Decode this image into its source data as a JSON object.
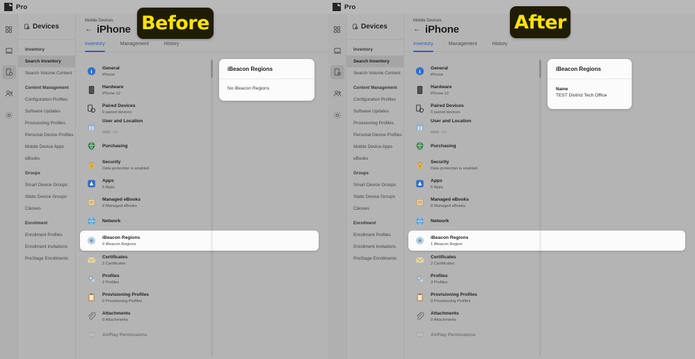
{
  "app": {
    "logo_text": "Pro",
    "logo_icon": "jamf-pro-logo-icon"
  },
  "rail": {
    "items": [
      {
        "name": "dashboard-icon",
        "label": "Dashboard",
        "active": false
      },
      {
        "name": "computers-icon",
        "label": "Computers",
        "active": false
      },
      {
        "name": "devices-icon",
        "label": "Devices",
        "active": true
      },
      {
        "name": "users-icon",
        "label": "Users",
        "active": false
      },
      {
        "name": "settings-gear-icon",
        "label": "Settings",
        "active": false
      }
    ]
  },
  "nav": {
    "header": "Devices",
    "header_icon": "device-icon",
    "groups": [
      {
        "title": "Inventory",
        "items": [
          {
            "label": "Search Inventory",
            "active": true
          },
          {
            "label": "Search Volume Content",
            "active": false
          }
        ]
      },
      {
        "title": "Content Management",
        "items": [
          {
            "label": "Configuration Profiles",
            "active": false
          },
          {
            "label": "Software Updates",
            "active": false
          },
          {
            "label": "Provisioning Profiles",
            "active": false
          },
          {
            "label": "Personal Device Profiles",
            "active": false
          },
          {
            "label": "Mobile Device Apps",
            "active": false
          },
          {
            "label": "eBooks",
            "active": false
          }
        ]
      },
      {
        "title": "Groups",
        "items": [
          {
            "label": "Smart Device Groups",
            "active": false
          },
          {
            "label": "Static Device Groups",
            "active": false
          },
          {
            "label": "Classes",
            "active": false
          }
        ]
      },
      {
        "title": "Enrollment",
        "items": [
          {
            "label": "Enrollment Profiles",
            "active": false
          },
          {
            "label": "Enrollment Invitations",
            "active": false
          },
          {
            "label": "PreStage Enrollments",
            "active": false
          }
        ]
      }
    ]
  },
  "header": {
    "breadcrumb": "Mobile Devices",
    "back_icon": "back-arrow-icon",
    "title": "iPhone"
  },
  "tabs": [
    {
      "label": "Inventory",
      "active": true
    },
    {
      "label": "Management",
      "active": false
    },
    {
      "label": "History",
      "active": false
    }
  ],
  "before": {
    "badge": "Before",
    "inventory": [
      {
        "icon": "general-info-icon",
        "title": "General",
        "sub": "iPhone",
        "selected": false,
        "faded": false
      },
      {
        "icon": "hardware-icon",
        "title": "Hardware",
        "sub": "iPhone 12",
        "selected": false,
        "faded": false
      },
      {
        "icon": "paired-devices-icon",
        "title": "Paired Devices",
        "sub": "0 paired devices",
        "selected": false,
        "faded": false
      },
      {
        "icon": "user-location-icon",
        "title": "User and Location",
        "sub": "",
        "redacted": true,
        "selected": false,
        "faded": false
      },
      {
        "icon": "purchasing-icon",
        "title": "Purchasing",
        "sub": "",
        "selected": false,
        "faded": false
      },
      {
        "icon": "security-lock-icon",
        "title": "Security",
        "sub": "Data protection is enabled",
        "selected": false,
        "faded": false
      },
      {
        "icon": "apps-icon",
        "title": "Apps",
        "sub": "6 Apps",
        "selected": false,
        "faded": false
      },
      {
        "icon": "managed-ebooks-icon",
        "title": "Managed eBooks",
        "sub": "0 Managed eBooks",
        "selected": false,
        "faded": false
      },
      {
        "icon": "network-icon",
        "title": "Network",
        "sub": "",
        "selected": false,
        "faded": false
      },
      {
        "icon": "ibeacon-regions-icon",
        "title": "iBeacon Regions",
        "sub": "0 iBeacon Regions",
        "selected": true,
        "faded": false
      },
      {
        "icon": "certificates-icon",
        "title": "Certificates",
        "sub": "2 Certificates",
        "selected": false,
        "faded": false
      },
      {
        "icon": "profiles-icon",
        "title": "Profiles",
        "sub": "2 Profiles",
        "selected": false,
        "faded": false
      },
      {
        "icon": "provisioning-profiles-icon",
        "title": "Provisioning Profiles",
        "sub": "0 Provisioning Profiles",
        "selected": false,
        "faded": false
      },
      {
        "icon": "attachments-icon",
        "title": "Attachments",
        "sub": "0 Attachments",
        "selected": false,
        "faded": false
      },
      {
        "icon": "airplay-permissions-icon",
        "title": "AirPlay Permissions",
        "sub": "",
        "selected": false,
        "faded": true
      }
    ],
    "card": {
      "title": "iBeacon Regions",
      "empty_text": "No iBeacon Regions"
    }
  },
  "after": {
    "badge": "After",
    "inventory": [
      {
        "icon": "general-info-icon",
        "title": "General",
        "sub": "iPhone",
        "selected": false,
        "faded": false
      },
      {
        "icon": "hardware-icon",
        "title": "Hardware",
        "sub": "iPhone 12",
        "selected": false,
        "faded": false
      },
      {
        "icon": "paired-devices-icon",
        "title": "Paired Devices",
        "sub": "0 paired devices",
        "selected": false,
        "faded": false
      },
      {
        "icon": "user-location-icon",
        "title": "User and Location",
        "sub": "",
        "redacted": true,
        "selected": false,
        "faded": false
      },
      {
        "icon": "purchasing-icon",
        "title": "Purchasing",
        "sub": "",
        "selected": false,
        "faded": false
      },
      {
        "icon": "security-lock-icon",
        "title": "Security",
        "sub": "Data protection is enabled",
        "selected": false,
        "faded": false
      },
      {
        "icon": "apps-icon",
        "title": "Apps",
        "sub": "6 Apps",
        "selected": false,
        "faded": false
      },
      {
        "icon": "managed-ebooks-icon",
        "title": "Managed eBooks",
        "sub": "0 Managed eBooks",
        "selected": false,
        "faded": false
      },
      {
        "icon": "network-icon",
        "title": "Network",
        "sub": "",
        "selected": false,
        "faded": false
      },
      {
        "icon": "ibeacon-regions-icon",
        "title": "iBeacon Regions",
        "sub": "1 iBeacon Region",
        "selected": true,
        "faded": false
      },
      {
        "icon": "certificates-icon",
        "title": "Certificates",
        "sub": "2 Certificates",
        "selected": false,
        "faded": false
      },
      {
        "icon": "profiles-icon",
        "title": "Profiles",
        "sub": "3 Profiles",
        "selected": false,
        "faded": false
      },
      {
        "icon": "provisioning-profiles-icon",
        "title": "Provisioning Profiles",
        "sub": "0 Provisioning Profiles",
        "selected": false,
        "faded": false
      },
      {
        "icon": "attachments-icon",
        "title": "Attachments",
        "sub": "0 Attachments",
        "selected": false,
        "faded": false
      },
      {
        "icon": "airplay-permissions-icon",
        "title": "AirPlay Permissions",
        "sub": "",
        "selected": false,
        "faded": true
      }
    ],
    "card": {
      "title": "iBeacon Regions",
      "field_label": "Name",
      "field_value": "TEST District Tech Office"
    }
  },
  "colors": {
    "accent_blue": "#2f5fb5",
    "badge_bg": "#1f1c05",
    "badge_text": "#ffe400",
    "app_bg": "#b4b4b4",
    "card_bg": "#fbfbfb"
  }
}
